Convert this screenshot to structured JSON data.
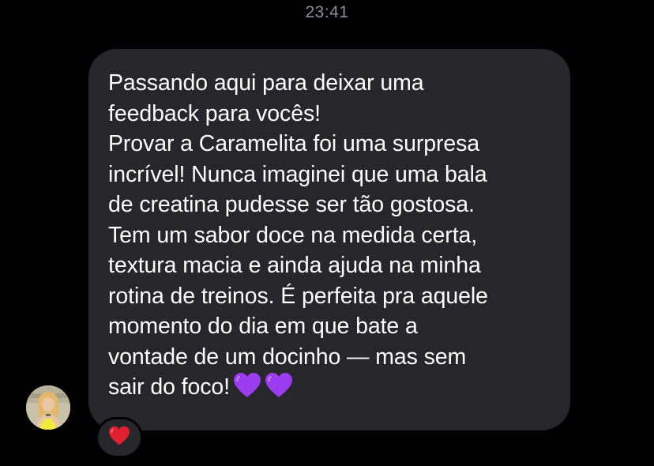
{
  "timestamp": "23:41",
  "message": {
    "lines": [
      "Passando aqui para deixar uma",
      "feedback para vocês!",
      "Provar a Caramelita foi uma surpresa",
      "incrível! Nunca imaginei que uma bala",
      "de creatina pudesse ser tão gostosa.",
      "Tem um sabor doce na medida certa,",
      "textura macia e ainda ajuda na minha",
      "rotina de treinos. É perfeita pra aquele",
      "momento do dia em que bate a",
      "vontade de um docinho — mas sem",
      "sair do foco!"
    ],
    "emojis": [
      "purple-heart-icon",
      "purple-heart-icon"
    ]
  },
  "reaction": {
    "icon": "red-heart-icon"
  },
  "colors": {
    "background": "#000000",
    "bubble": "#26262b",
    "text": "#ffffff",
    "timestamp": "#8e8e93",
    "purple_heart": "#9b3cf0",
    "red_heart": "#e0202e"
  }
}
